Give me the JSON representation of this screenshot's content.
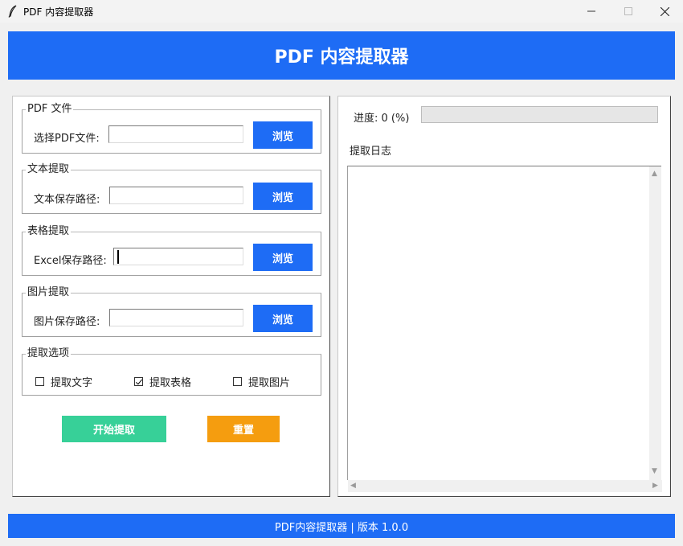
{
  "window": {
    "title": "PDF 内容提取器",
    "icon": "feather-icon"
  },
  "header": {
    "title": "PDF 内容提取器"
  },
  "pdf_group": {
    "legend": "PDF 文件",
    "label": "选择PDF文件:",
    "value": "",
    "browse_label": "浏览"
  },
  "text_group": {
    "legend": "文本提取",
    "label": "文本保存路径:",
    "value": "",
    "browse_label": "浏览"
  },
  "table_group": {
    "legend": "表格提取",
    "label": "Excel保存路径:",
    "value": "",
    "browse_label": "浏览"
  },
  "image_group": {
    "legend": "图片提取",
    "label": "图片保存路径:",
    "value": "",
    "browse_label": "浏览"
  },
  "options": {
    "legend": "提取选项",
    "extract_text": {
      "label": "提取文字",
      "checked": false
    },
    "extract_table": {
      "label": "提取表格",
      "checked": true
    },
    "extract_image": {
      "label": "提取图片",
      "checked": false
    }
  },
  "actions": {
    "start_label": "开始提取",
    "reset_label": "重置"
  },
  "progress": {
    "label": "进度: 0 (%)",
    "value": 0
  },
  "log": {
    "label": "提取日志",
    "content": ""
  },
  "footer": {
    "text": "PDF内容提取器 | 版本 1.0.0"
  },
  "colors": {
    "primary": "#1e6cf5",
    "start": "#37d098",
    "reset": "#f59d0f"
  }
}
